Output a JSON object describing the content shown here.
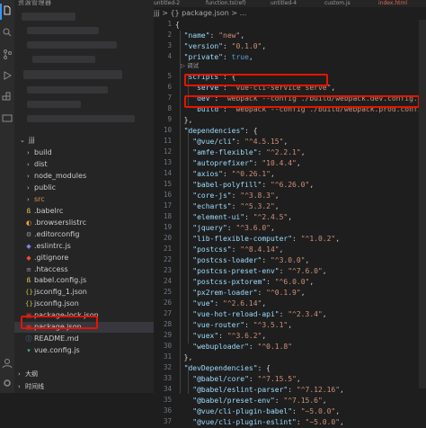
{
  "sidebar": {
    "title": "资源管理器",
    "project_folder": "jjj",
    "tree": [
      {
        "label": "build",
        "type": "folder",
        "icon": "folder-icon"
      },
      {
        "label": "dist",
        "type": "folder",
        "icon": "folder-icon"
      },
      {
        "label": "node_modules",
        "type": "folder",
        "icon": "folder-icon"
      },
      {
        "label": "public",
        "type": "folder",
        "icon": "folder-icon"
      },
      {
        "label": "src",
        "type": "folder",
        "icon": "folder-icon"
      },
      {
        "label": ".babelrc",
        "type": "file",
        "icon": "babel-icon"
      },
      {
        "label": ".browserslistrc",
        "type": "file",
        "icon": "browserslist-icon"
      },
      {
        "label": ".editorconfig",
        "type": "file",
        "icon": "gear-icon"
      },
      {
        "label": ".eslintrc.js",
        "type": "file",
        "icon": "eslint-icon"
      },
      {
        "label": ".gitignore",
        "type": "file",
        "icon": "git-icon"
      },
      {
        "label": ".htaccess",
        "type": "file",
        "icon": "config-icon"
      },
      {
        "label": "babel.config.js",
        "type": "file",
        "icon": "babel-icon"
      },
      {
        "label": "jsconfig_1.json",
        "type": "file",
        "icon": "json-icon"
      },
      {
        "label": "jsconfig.json",
        "type": "file",
        "icon": "json-icon"
      },
      {
        "label": "package-lock.json",
        "type": "file",
        "icon": "npm-icon"
      },
      {
        "label": "package.json",
        "type": "file",
        "icon": "npm-icon",
        "selected": true
      },
      {
        "label": "README.md",
        "type": "file",
        "icon": "info-icon"
      },
      {
        "label": "vue.config.js",
        "type": "file",
        "icon": "vue-icon"
      }
    ],
    "outline_label": "大纲",
    "timeline_label": "时间线"
  },
  "editor": {
    "tabs": [
      "untitled-2",
      "function.ts(ref)",
      "untitled-4",
      "custom.js",
      "index.html"
    ],
    "breadcrumb": "jjj  >  {} package.json  >  ...",
    "codelens_debug": "▷ 调试",
    "lines": [
      {
        "n": "1",
        "t": "{"
      },
      {
        "n": "2",
        "t": "  \"name\": \"new\","
      },
      {
        "n": "3",
        "t": "  \"version\": \"0.1.0\","
      },
      {
        "n": "4",
        "t": "  \"private\": true,"
      },
      {
        "n": "5",
        "t": "  \"scripts\": {"
      },
      {
        "n": "6",
        "t": "    \"serve\": \"vue-cli-service serve\","
      },
      {
        "n": "7",
        "t": "    \"dev\": \"webpack --config ./build/webpack.dev.config.js\","
      },
      {
        "n": "8",
        "t": "    \"build\": \"webpack --config ./build/webpack.prod.config.js\""
      },
      {
        "n": "9",
        "t": "  },"
      },
      {
        "n": "10",
        "t": "  \"dependencies\": {"
      },
      {
        "n": "11",
        "t": "    \"@vue/cli\": \"^4.5.15\","
      },
      {
        "n": "12",
        "t": "    \"amfe-flexible\": \"^2.2.1\","
      },
      {
        "n": "13",
        "t": "    \"autoprefixer\": \"10.4.4\","
      },
      {
        "n": "14",
        "t": "    \"axios\": \"^0.26.1\","
      },
      {
        "n": "15",
        "t": "    \"babel-polyfill\": \"^6.26.0\","
      },
      {
        "n": "16",
        "t": "    \"core-js\": \"^3.8.3\","
      },
      {
        "n": "17",
        "t": "    \"echarts\": \"^5.3.2\","
      },
      {
        "n": "18",
        "t": "    \"element-ui\": \"^2.4.5\","
      },
      {
        "n": "19",
        "t": "    \"jquery\": \"^3.6.0\","
      },
      {
        "n": "20",
        "t": "    \"lib-flexible-computer\": \"^1.0.2\","
      },
      {
        "n": "21",
        "t": "    \"postcss\": \"^8.4.14\","
      },
      {
        "n": "22",
        "t": "    \"postcss-loader\": \"^3.0.0\","
      },
      {
        "n": "23",
        "t": "    \"postcss-preset-env\": \"^7.6.0\","
      },
      {
        "n": "24",
        "t": "    \"postcss-pxtorem\": \"^6.0.0\","
      },
      {
        "n": "25",
        "t": "    \"px2rem-loader\": \"^0.1.9\","
      },
      {
        "n": "26",
        "t": "    \"vue\": \"^2.6.14\","
      },
      {
        "n": "27",
        "t": "    \"vue-hot-reload-api\": \"^2.3.4\","
      },
      {
        "n": "28",
        "t": "    \"vue-router\": \"^3.5.1\","
      },
      {
        "n": "29",
        "t": "    \"vuex\": \"^3.6.2\","
      },
      {
        "n": "30",
        "t": "    \"webuploader\": \"^0.1.8\""
      },
      {
        "n": "31",
        "t": "  },"
      },
      {
        "n": "32",
        "t": "  \"devDependencies\": {"
      },
      {
        "n": "33",
        "t": "    \"@babel/core\": \"^7.15.5\","
      },
      {
        "n": "34",
        "t": "    \"@babel/eslint-parser\": \"^7.12.16\","
      },
      {
        "n": "35",
        "t": "    \"@babel/preset-env\": \"^7.15.6\","
      },
      {
        "n": "36",
        "t": "    \"@vue/cli-plugin-babel\": \"~5.0.0\","
      },
      {
        "n": "37",
        "t": "    \"@vue/cli-plugin-eslint\": \"~5.0.0\","
      }
    ]
  },
  "colors": {
    "highlight_box": "#e51400",
    "selected_row": "#37373d",
    "key": "#9cdcfe",
    "string": "#ce9178"
  }
}
